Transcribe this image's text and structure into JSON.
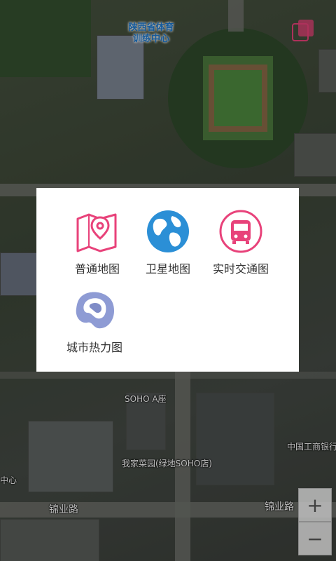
{
  "map": {
    "labels": {
      "sports_center": "陕西省体育\n训练中心",
      "soho_a": "SOHO A座",
      "restaurant": "我家菜园(绿地SOHO店)",
      "bank": "中国工商银行",
      "center_partial": "中心",
      "ji_ye_road_left": "锦业路",
      "ji_ye_road_right": "锦业路"
    }
  },
  "dialog": {
    "options": [
      {
        "label": "普通地图",
        "icon": "map-pin-icon"
      },
      {
        "label": "卫星地图",
        "icon": "globe-icon"
      },
      {
        "label": "实时交通图",
        "icon": "bus-icon"
      },
      {
        "label": "城市热力图",
        "icon": "heatmap-blob-icon"
      }
    ]
  },
  "controls": {
    "zoom_in": "+",
    "zoom_out": "−"
  },
  "colors": {
    "pink": "#e8427a",
    "globe_blue": "#2b8fd6",
    "heat_purple": "#7f8cc7"
  }
}
